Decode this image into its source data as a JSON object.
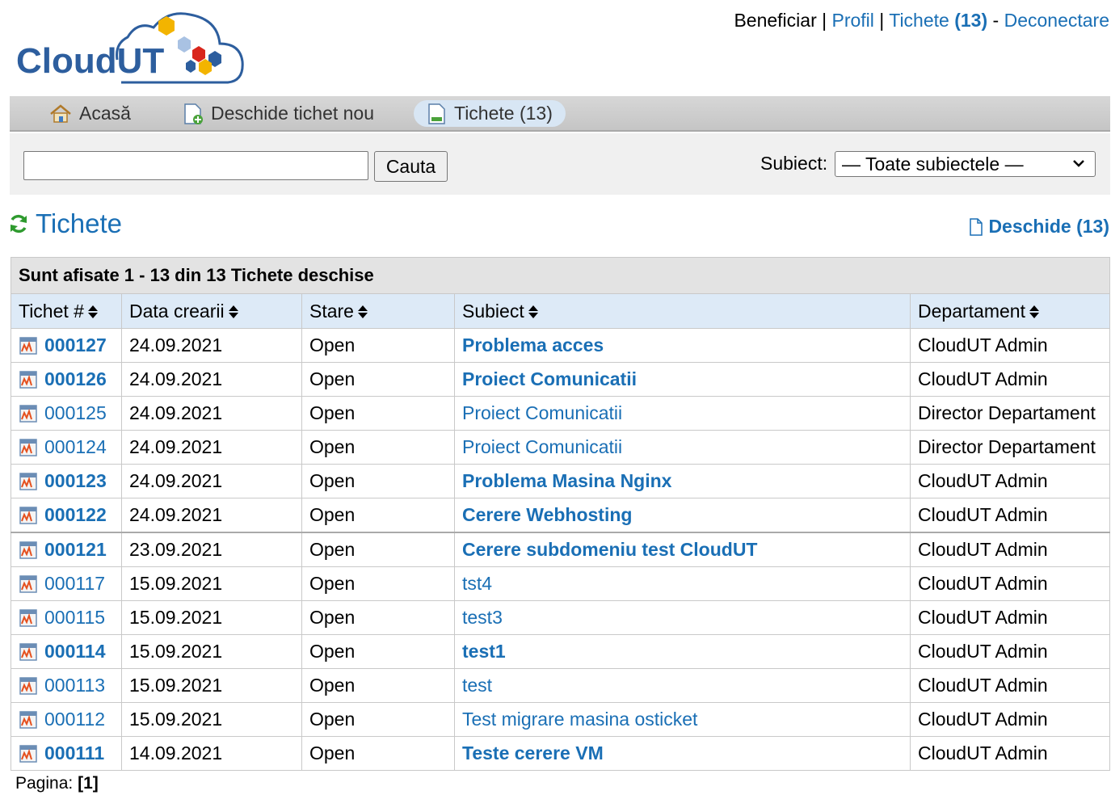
{
  "header": {
    "logo_text": "CloudUT",
    "user_label": "Beneficiar",
    "profile_link": "Profil",
    "tickets_link": "Tichete",
    "tickets_count": "(13)",
    "logout_link": "Deconectare",
    "sep1": " | ",
    "sep2": " | ",
    "sep3": " - "
  },
  "nav": {
    "home": "Acasă",
    "new_ticket": "Deschide tichet nou",
    "tickets": "Tichete (13)"
  },
  "search": {
    "button": "Cauta",
    "subject_label": "Subiect:",
    "subject_selected": "— Toate subiectele —"
  },
  "page": {
    "title": "Tichete",
    "open_link": "Deschide (13)"
  },
  "table": {
    "caption": "Sunt afisate 1 - 13 din 13 Tichete deschise",
    "columns": [
      "Tichet #",
      "Data crearii",
      "Stare",
      "Subiect",
      "Departament"
    ],
    "rows": [
      {
        "number": "000127",
        "date": "24.09.2021",
        "status": "Open",
        "subject": "Problema acces",
        "department": "CloudUT Admin",
        "unread": true
      },
      {
        "number": "000126",
        "date": "24.09.2021",
        "status": "Open",
        "subject": "Proiect Comunicatii",
        "department": "CloudUT Admin",
        "unread": true
      },
      {
        "number": "000125",
        "date": "24.09.2021",
        "status": "Open",
        "subject": "Proiect Comunicatii",
        "department": "Director Departament",
        "unread": false
      },
      {
        "number": "000124",
        "date": "24.09.2021",
        "status": "Open",
        "subject": "Proiect Comunicatii",
        "department": "Director Departament",
        "unread": false
      },
      {
        "number": "000123",
        "date": "24.09.2021",
        "status": "Open",
        "subject": "Problema Masina Nginx",
        "department": "CloudUT Admin",
        "unread": true
      },
      {
        "number": "000122",
        "date": "24.09.2021",
        "status": "Open",
        "subject": "Cerere Webhosting",
        "department": "CloudUT Admin",
        "unread": true
      },
      {
        "number": "000121",
        "date": "23.09.2021",
        "status": "Open",
        "subject": "Cerere subdomeniu test CloudUT",
        "department": "CloudUT Admin",
        "unread": true
      },
      {
        "number": "000117",
        "date": "15.09.2021",
        "status": "Open",
        "subject": "tst4",
        "department": "CloudUT Admin",
        "unread": false
      },
      {
        "number": "000115",
        "date": "15.09.2021",
        "status": "Open",
        "subject": "test3",
        "department": "CloudUT Admin",
        "unread": false
      },
      {
        "number": "000114",
        "date": "15.09.2021",
        "status": "Open",
        "subject": "test1",
        "department": "CloudUT Admin",
        "unread": true
      },
      {
        "number": "000113",
        "date": "15.09.2021",
        "status": "Open",
        "subject": "test",
        "department": "CloudUT Admin",
        "unread": false
      },
      {
        "number": "000112",
        "date": "15.09.2021",
        "status": "Open",
        "subject": "Test migrare masina osticket",
        "department": "CloudUT Admin",
        "unread": false
      },
      {
        "number": "000111",
        "date": "14.09.2021",
        "status": "Open",
        "subject": "Teste cerere VM",
        "department": "CloudUT Admin",
        "unread": true
      }
    ]
  },
  "pager": {
    "label": "Pagina:",
    "current": "[1]"
  },
  "colors": {
    "link": "#1a6fb5",
    "brand_dark": "#2d5e9e",
    "brand_red": "#d9261c",
    "header_blue": "#ddeaf7"
  }
}
